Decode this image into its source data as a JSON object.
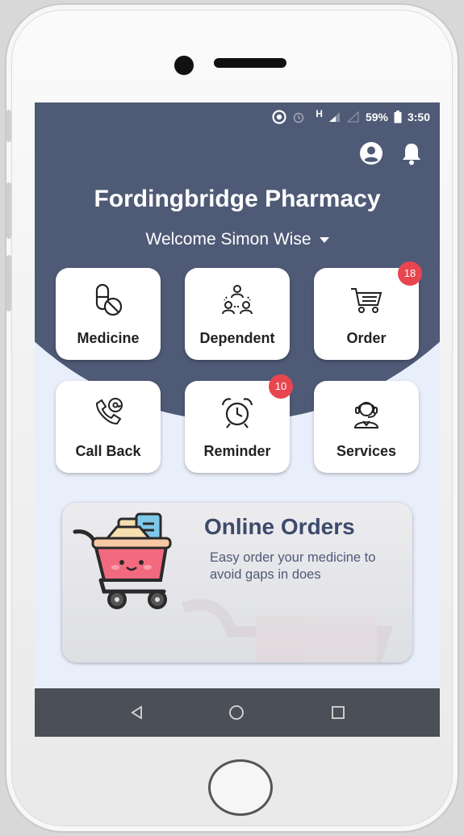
{
  "status_bar": {
    "network": "H",
    "battery": "59%",
    "time": "3:50"
  },
  "app": {
    "title": "Fordingbridge Pharmacy",
    "welcome": "Welcome Simon Wise"
  },
  "tiles": [
    {
      "label": "Medicine",
      "icon": "pills-icon",
      "badge": ""
    },
    {
      "label": "Dependent",
      "icon": "people-group-icon",
      "badge": ""
    },
    {
      "label": "Order",
      "icon": "cart-icon",
      "badge": "18"
    },
    {
      "label": "Call Back",
      "icon": "phone-callback-icon",
      "badge": ""
    },
    {
      "label": "Reminder",
      "icon": "alarm-clock-icon",
      "badge": "10"
    },
    {
      "label": "Services",
      "icon": "support-agent-icon",
      "badge": ""
    }
  ],
  "banner": {
    "title": "Online Orders",
    "text": "Easy order your medicine to avoid gaps in does"
  },
  "colors": {
    "header": "#4f5a76",
    "background": "#e8eefa",
    "badge": "#e8464f",
    "navbar": "#4b4f57"
  }
}
